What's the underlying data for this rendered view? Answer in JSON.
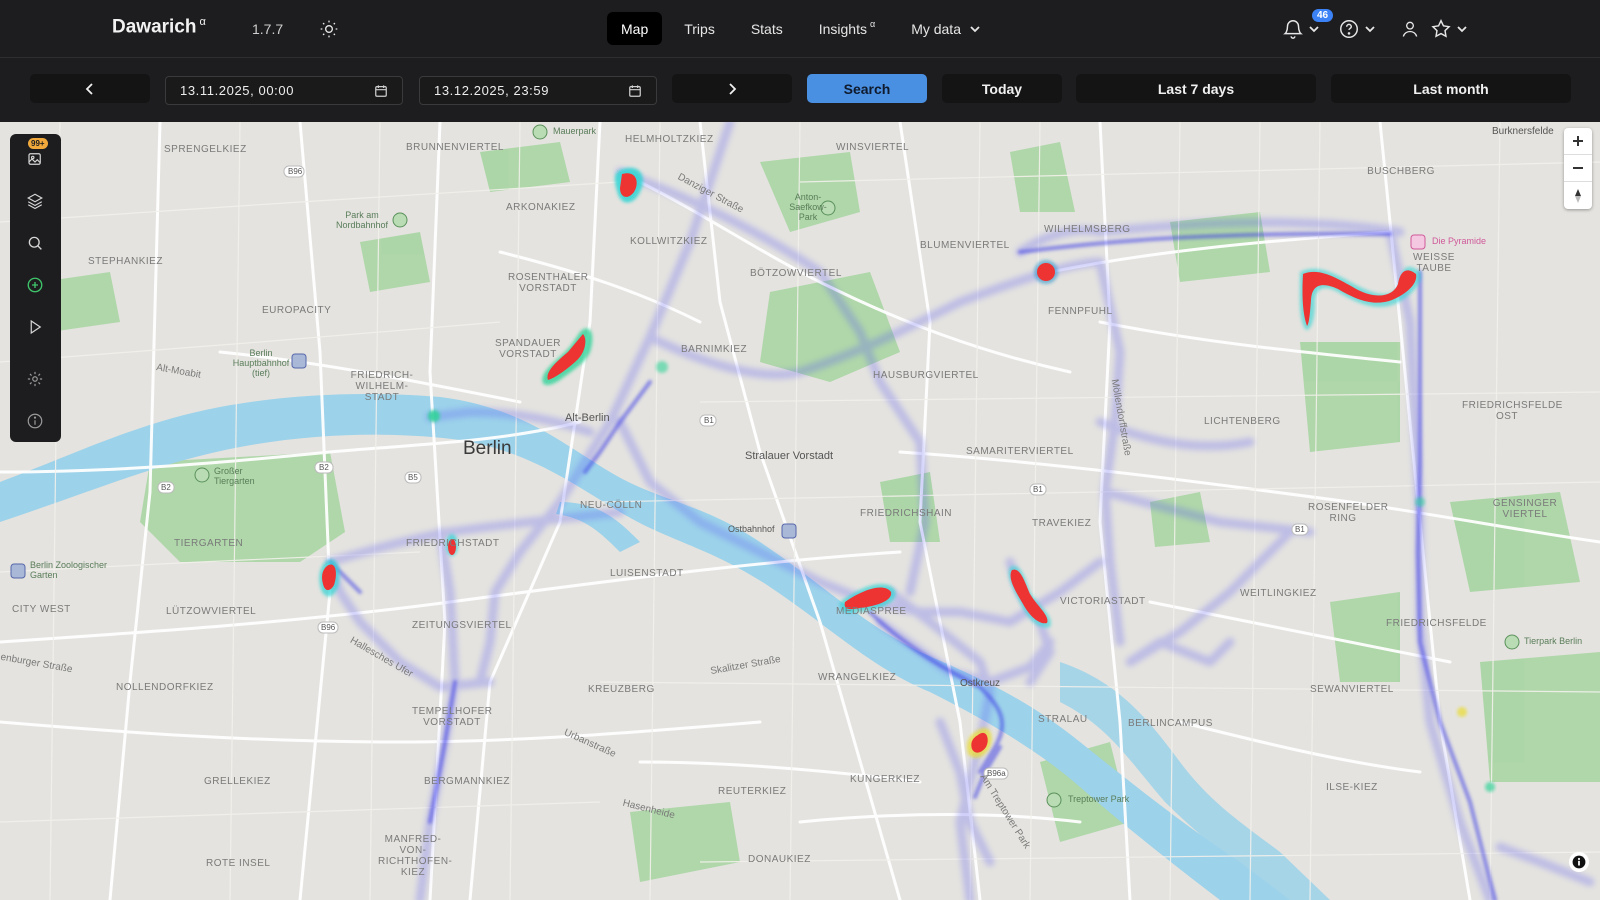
{
  "app": {
    "name": "Dawarich",
    "name_sup": "α",
    "version": "1.7.7"
  },
  "nav": {
    "items": [
      {
        "label": "Map",
        "active": true
      },
      {
        "label": "Trips"
      },
      {
        "label": "Stats"
      },
      {
        "label": "Insights",
        "sup": "α"
      },
      {
        "label": "My data"
      }
    ],
    "notifications_count": "46"
  },
  "toolbar": {
    "start_date": "13.11.2025, 00:00",
    "end_date": "13.12.2025, 23:59",
    "search_label": "Search",
    "today_label": "Today",
    "last7_label": "Last 7 days",
    "last_month_label": "Last month"
  },
  "map": {
    "side_badge": "99+",
    "labels": {
      "berlin": "Berlin",
      "alt_berlin": "Alt-Berlin",
      "stralauer": "Stralauer Vorstadt",
      "ostbahnhof": "Ostbahnhof",
      "ostkreuz": "Ostkreuz",
      "hauptbahnhof": "Berlin Hauptbahnhof (tief)",
      "sprengelkiez": "SPRENGELKIEZ",
      "brunnenviertel": "BRUNNENVIERTEL",
      "mauerpark": "Mauerpark",
      "helmholtzkiez": "HELMHOLTZKIEZ",
      "arkonakiez": "ARKONAKIEZ",
      "kollwitzkiez": "KOLLWITZKIEZ",
      "stephankiez": "STEPHANKIEZ",
      "europacity": "EUROPACITY",
      "rosenthaler": "ROSENTHALER VORSTADT",
      "spandauer": "SPANDAUER VORSTADT",
      "friedrich_wilhelm": "FRIEDRICH-WILHELM-STADT",
      "barnimkiez": "BARNIMKIEZ",
      "boetzow": "BÖTZOWVIERTEL",
      "winsviertel": "WINSVIERTEL",
      "blumenviertel": "BLUMENVIERTEL",
      "wilhelmsberg": "WILHELMSBERG",
      "hausburg": "HAUSBURGVIERTEL",
      "fennpfuhl": "FENNPFUHL",
      "lichtenberg": "LICHTENBERG",
      "samariter": "SAMARITERVIERTEL",
      "friedrichshain": "FRIEDRICHSHAIN",
      "travekiez": "TRAVEKIEZ",
      "rosenfelder": "ROSENFELDER RING",
      "weitlingkiez": "WEITLINGKIEZ",
      "victoriastadt": "VICTORIASTADT",
      "mediaspree": "MEDIASPREE",
      "neu_coelln": "NEU-CÖLLN",
      "luisenstadt": "LUISENSTADT",
      "friedrichstadt": "FRIEDRICHSTADT",
      "tiergarten": "TIERGARTEN",
      "grosser_tiergarten": "Großer Tiergarten",
      "zoo": "Berlin Zoologischer Garten",
      "city_west": "CITY WEST",
      "luetzow": "LÜTZOWVIERTEL",
      "zeitungs": "ZEITUNGSVIERTEL",
      "nollendorf": "NOLLENDORFKIEZ",
      "tempelhofer": "TEMPELHOFER VORSTADT",
      "kreuzberg": "KREUZBERG",
      "wrangelkiez": "WRANGELKIEZ",
      "reuterkiez": "REUTERKIEZ",
      "kungerkiez": "KUNGERKIEZ",
      "bergmannkiez": "BERGMANNKIEZ",
      "grellekiez": "GRELLEKIEZ",
      "rote_insel": "ROTE INSEL",
      "manfred": "MANFRED-VON-RICHTHOFEN-KIEZ",
      "donaukiez": "DONAUKIEZ",
      "stralau": "STRALAU",
      "berlincampus": "BERLINCAMPUS",
      "treptower": "Treptower Park",
      "sewan": "SEWANVIERTEL",
      "ilse": "ILSE-KIEZ",
      "friedrichsfelde": "FRIEDRICHSFELDE",
      "friedrichsfelde_ost": "FRIEDRICHSFELDE OST",
      "gensinger": "GENSINGER VIERTEL",
      "weisse_taube": "WEISSE TAUBE",
      "buschberg": "BUSCHBERG",
      "burknersfelde": "Burknersfelde",
      "pyramide": "Die Pyramide",
      "tierpark": "Tierpark Berlin",
      "park_nordbahnhof": "Park am Nordbahnhof",
      "anton_saefkow": "Anton-Saefkow-Park",
      "danziger": "Danziger Straße",
      "moellendorff": "Möllendorffstraße",
      "skalitzer": "Skalitzer Straße",
      "urbanstr": "Urbanstraße",
      "hasenheide": "Hasenheide",
      "hallesches": "Hallesches Ufer",
      "alt_moabit": "Alt-Moabit",
      "am_treptower": "Am Treptower Park",
      "zenburger": "enburger Straße"
    }
  }
}
